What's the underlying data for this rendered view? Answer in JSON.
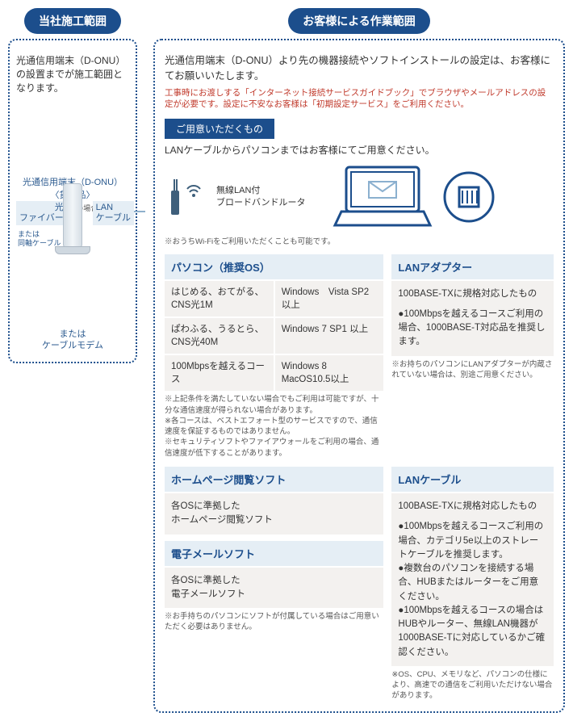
{
  "left": {
    "title": "当社施工範囲",
    "desc": "光通信用端末（D-ONU）の設置までが施工範囲となります。",
    "fiber_label": "光\nファイバー",
    "or_coax": "または\n同軸ケーブル",
    "lan_label": "LAN\nケーブル",
    "donu_caption": "光通信用端末（D-ONU）\n〈貸出品〉",
    "cns_note": "※CNS光の場合",
    "or_modem": "または\nケーブルモデム"
  },
  "right": {
    "title": "お客様による作業範囲",
    "desc1": "光通信用端末（D-ONU）より先の機器接続やソフトインストールの設定は、お客様にてお願いいたします。",
    "desc2": "工事時にお渡しする「インターネット接続サービスガイドブック」でブラウザやメールアドレスの設定が必要です。設定に不安なお客様は「初期設定サービス」をご利用ください。",
    "prepare_title": "ご用意いただくもの",
    "prepare_text": "LANケーブルからパソコンまではお客様にてご用意ください。",
    "router_label": "無線LAN付\nブロードバンドルータ",
    "wifi_note": "※おうちWi-Fiをご利用いただくことも可能です。",
    "sections": {
      "pc_head": "パソコン（推奨OS）",
      "pc_rows": [
        {
          "c1": "はじめる、おてがる、CNS光1M",
          "c2": "Windows　Vista SP2 以上"
        },
        {
          "c1": "ぱわふる、うるとら、CNS光40M",
          "c2": "Windows 7 SP1 以上"
        },
        {
          "c1": "100Mbpsを越えるコース",
          "c2": "Windows 8　MacOS10.5以上"
        }
      ],
      "pc_notes": "※上記条件を満たしていない場合でもご利用は可能ですが、十分な通信速度が得られない場合があります。\n※各コースは、ベストエフォート型のサービスですので、通信速度を保証するものではありません。\n※セキュリティソフトやファイアウォールをご利用の場合、通信速度が低下することがあります。",
      "lanadapter_head": "LANアダプター",
      "lanadapter_body_line1": "100BASE-TXに規格対応したもの",
      "lanadapter_body_bullet": "100Mbpsを越えるコースご利用の場合、1000BASE-T対応品を推奨します。",
      "lanadapter_note": "※お持ちのパソコンにLANアダプターが内蔵されていない場合は、別途ご用意ください。",
      "browser_head": "ホームページ閲覧ソフト",
      "browser_body": "各OSに準拠した\nホームページ閲覧ソフト",
      "mail_head": "電子メールソフト",
      "mail_body": "各OSに準拠した\n電子メールソフト",
      "soft_note": "※お手持ちのパソコンにソフトが付属している場合はご用意いただく必要はありません。",
      "lancable_head": "LANケーブル",
      "lancable_line1": "100BASE-TXに規格対応したもの",
      "lancable_bullets": [
        "100Mbpsを越えるコースご利用の場合、カテゴリ5e以上のストレートケーブルを推奨します。",
        "複数台のパソコンを接続する場合、HUBまたはルーターをご用意ください。",
        "100Mbpsを越えるコースの場合はHUBやルーター、無線LAN機器が1000BASE-Tに対応しているかご確認ください。"
      ],
      "lancable_note": "※OS、CPU、メモリなど、パソコンの仕様により、高速での通信をご利用いただけない場合があります。"
    }
  }
}
